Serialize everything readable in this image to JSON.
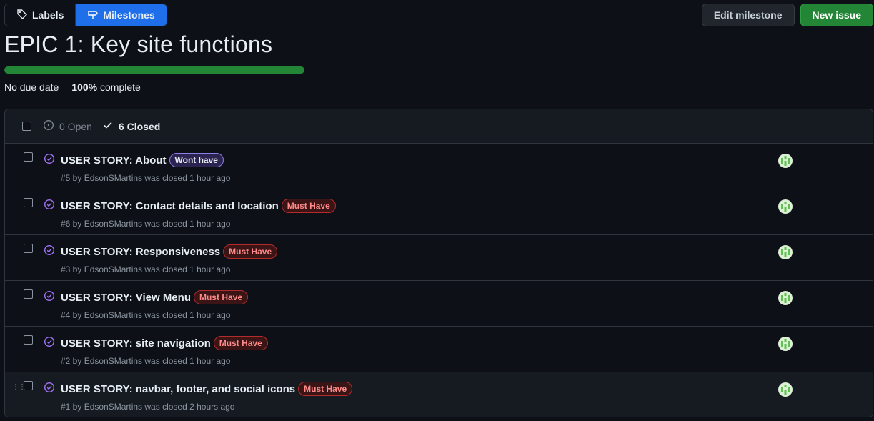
{
  "toolbar": {
    "labels_tab": "Labels",
    "milestones_tab": "Milestones",
    "edit_milestone": "Edit milestone",
    "new_issue": "New issue"
  },
  "milestone": {
    "title": "EPIC 1: Key site functions",
    "due": "No due date",
    "percent": "100%",
    "complete_word": "complete",
    "progress_fraction": 1.0
  },
  "filters": {
    "open": "0 Open",
    "closed": "6 Closed"
  },
  "issues": [
    {
      "title": "USER STORY: About",
      "label": "Wont have",
      "label_kind": "wont",
      "meta": "#5 by EdsonSMartins was closed 1 hour ago"
    },
    {
      "title": "USER STORY: Contact details and location",
      "label": "Must Have",
      "label_kind": "must",
      "meta": "#6 by EdsonSMartins was closed 1 hour ago"
    },
    {
      "title": "USER STORY: Responsiveness",
      "label": "Must Have",
      "label_kind": "must",
      "meta": "#3 by EdsonSMartins was closed 1 hour ago"
    },
    {
      "title": "USER STORY: View Menu",
      "label": "Must Have",
      "label_kind": "must",
      "meta": "#4 by EdsonSMartins was closed 1 hour ago"
    },
    {
      "title": "USER STORY: site navigation",
      "label": "Must Have",
      "label_kind": "must",
      "meta": "#2 by EdsonSMartins was closed 1 hour ago"
    },
    {
      "title": "USER STORY: navbar, footer, and social icons",
      "label": "Must Have",
      "label_kind": "must",
      "meta": "#1 by EdsonSMartins was closed 2 hours ago"
    }
  ],
  "colors": {
    "accent_blue": "#1f6feb",
    "success_green": "#238636",
    "closed_purple": "#a371f7",
    "must_have_red": "#ff8a8a",
    "wont_have_purple": "#8b7fe8"
  }
}
